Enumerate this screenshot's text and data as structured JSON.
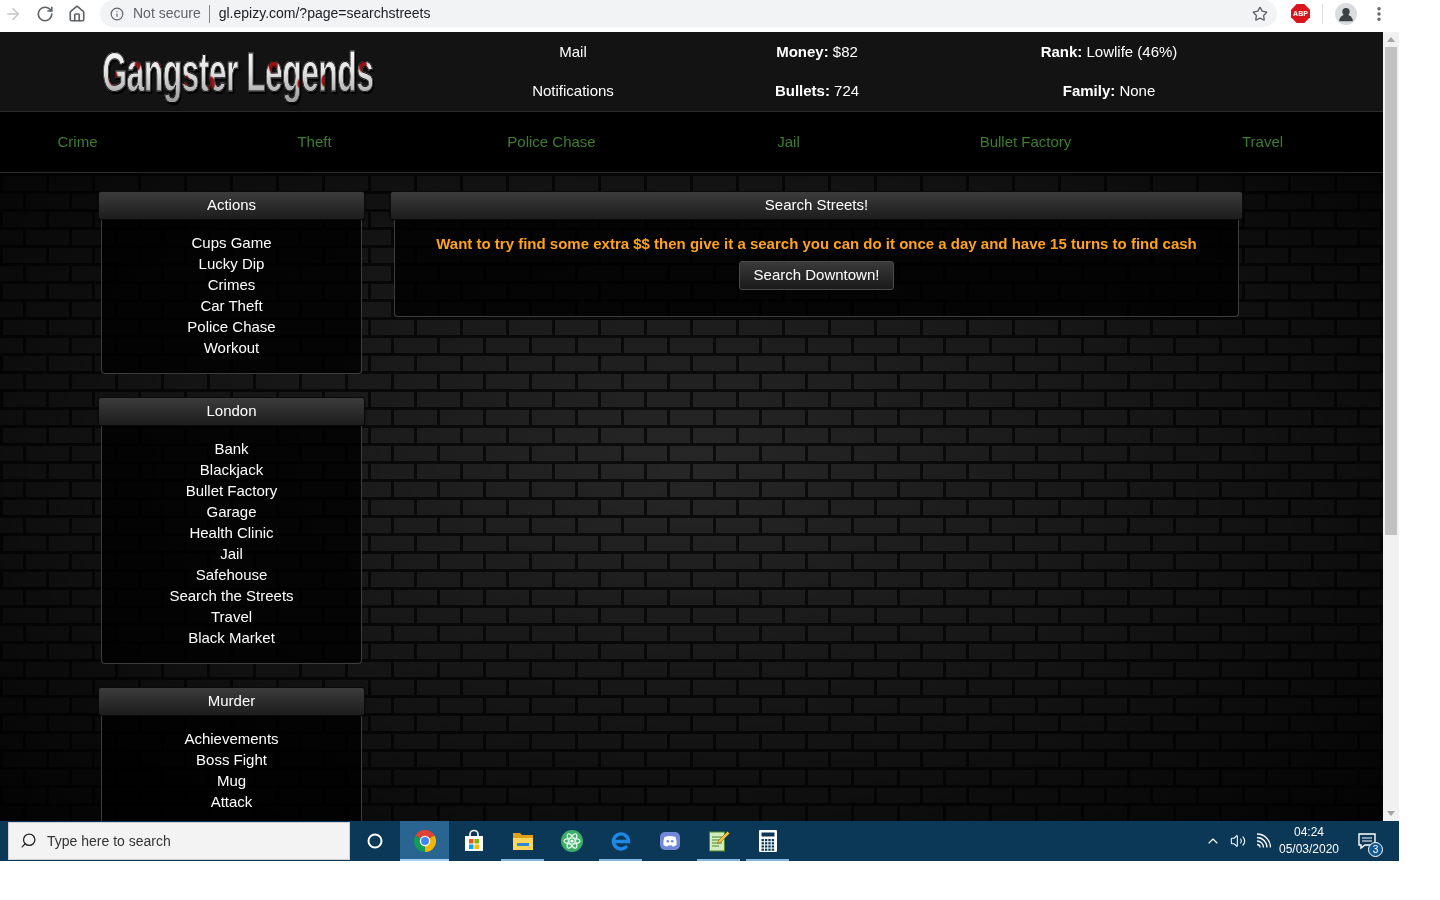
{
  "browser": {
    "nav_buttons": [
      {
        "kind": "forward",
        "disabled": true
      },
      {
        "kind": "reload",
        "disabled": false
      },
      {
        "kind": "home",
        "disabled": false
      }
    ],
    "security_label": "Not secure",
    "url": "gl.epizy.com/?page=searchstreets",
    "extensions": [
      {
        "label": "ABP"
      }
    ]
  },
  "header": {
    "logo": "Gangster Legends",
    "rows": [
      {
        "link": "Mail",
        "stats": [
          {
            "label": "Money:",
            "value": "$82"
          },
          {
            "label": "Rank:",
            "value": "Lowlife (46%)"
          }
        ]
      },
      {
        "link": "Notifications",
        "stats": [
          {
            "label": "Bullets:",
            "value": "724"
          },
          {
            "label": "Family:",
            "value": "None"
          }
        ]
      }
    ]
  },
  "nav": [
    "Crime",
    "Theft",
    "Police Chase",
    "Jail",
    "Bullet Factory",
    "Travel"
  ],
  "sidebar": [
    {
      "title": "Actions",
      "items": [
        "Cups Game",
        "Lucky Dip",
        "Crimes",
        "Car Theft",
        "Police Chase",
        "Workout"
      ]
    },
    {
      "title": "London",
      "items": [
        "Bank",
        "Blackjack",
        "Bullet Factory",
        "Garage",
        "Health Clinic",
        "Jail",
        "Safehouse",
        "Search the Streets",
        "Travel",
        "Black Market"
      ]
    },
    {
      "title": "Murder",
      "items": [
        "Achievements",
        "Boss Fight",
        "Mug",
        "Attack"
      ]
    }
  ],
  "main_panel": {
    "title": "Search Streets!",
    "message": "Want to try find some extra $$ then give it a search you can do it once a day and have 15 turns to find cash",
    "button": "Search Downtown!"
  },
  "taskbar": {
    "search": {
      "placeholder": "Type here to search"
    },
    "apps": [
      {
        "kind": "chrome",
        "selected": true,
        "running": true
      },
      {
        "kind": "store",
        "selected": false,
        "running": false
      },
      {
        "kind": "explorer",
        "selected": false,
        "running": true
      },
      {
        "kind": "atom",
        "selected": false,
        "running": false
      },
      {
        "kind": "edge",
        "selected": false,
        "running": true
      },
      {
        "kind": "discord",
        "selected": false,
        "running": false
      },
      {
        "kind": "notepad",
        "selected": false,
        "running": true
      },
      {
        "kind": "calculator",
        "selected": false,
        "running": true
      }
    ],
    "clock": {
      "time": "04:24",
      "date": "05/03/2020"
    },
    "notification_count": "3"
  }
}
